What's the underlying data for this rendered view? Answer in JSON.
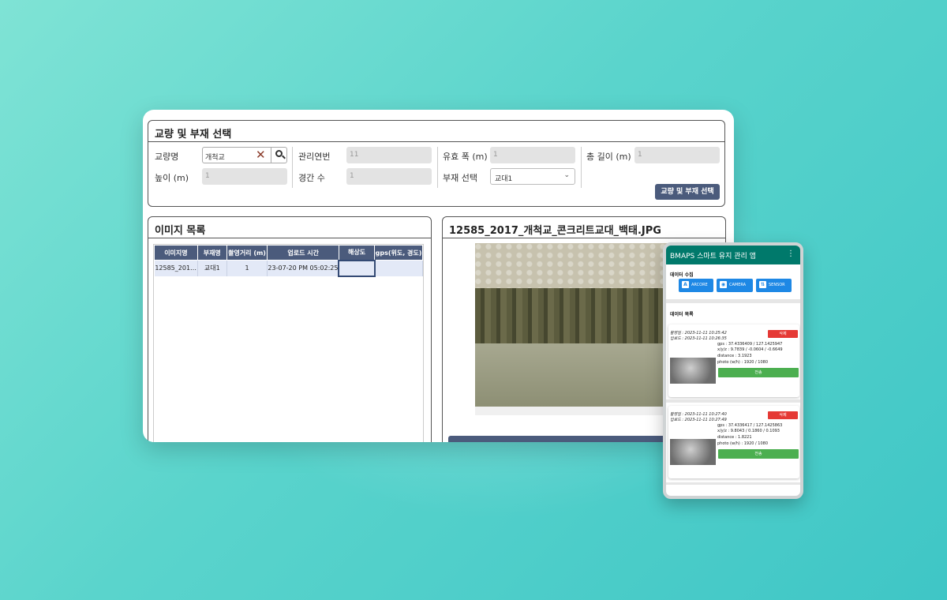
{
  "selection": {
    "title": "교량 및 부재 선택",
    "bridge_name_label": "교량명",
    "bridge_name_value": "개척교",
    "height_label": "높이 (m)",
    "height_value": "1",
    "mgmt_year_label": "관리연번",
    "mgmt_year_value": "11",
    "span_count_label": "경간 수",
    "span_count_value": "1",
    "width_label": "유효 폭 (m)",
    "width_value": "1",
    "member_label": "부재 선택",
    "member_value": "교대1",
    "total_length_label": "총 길이 (m)",
    "total_length_value": "1",
    "select_button": "교량 및 부재 선택"
  },
  "image_list": {
    "title": "이미지 목록",
    "columns": [
      "이미지명",
      "부재명",
      "촬영거리 (m)",
      "업로드 시간",
      "해상도",
      "gps(위도, 경도)"
    ],
    "rows": [
      [
        "12585_201…",
        "교대1",
        "1",
        "23-07-20 PM 05:02:25",
        "",
        ""
      ]
    ]
  },
  "image_view": {
    "title": "12585_2017_개척교_콘크리트교대_백태.JPG"
  },
  "phone": {
    "app_title": "BMAPS 스마트 유지 관리 앱",
    "collect_title": "데이터 수집",
    "buttons": [
      {
        "label": "ARCORE",
        "icon": "A"
      },
      {
        "label": "CAMERA",
        "icon": "camera-icon"
      },
      {
        "label": "SENSOR",
        "icon": "sensor-icon"
      }
    ],
    "list_title": "데이터 목록",
    "delete_label": "삭제",
    "send_label": "전송",
    "cards": [
      {
        "shot": "촬영일 : 2023-11-11 10:25:42",
        "upload": "업로드 : 2023-11-11 10:26:35",
        "gps": "gps : 37.4336409 / 127.1425947",
        "xyz": "x/y/z : 9.7839 / -0.0604 / -0.6649",
        "distance": "distance : 3.1923",
        "photo": "photo (w/h) : 1920 / 1080"
      },
      {
        "shot": "촬영일 : 2023-11-11 10:27:40",
        "upload": "업로드 : 2023-11-11 10:27:49",
        "gps": "gps : 37.4336417 / 127.1425863",
        "xyz": "x/y/z : 9.8043 / 0.1860 / 0.1093",
        "distance": "distance : 1.8221",
        "photo": "photo (w/h) : 1920 / 1080"
      }
    ]
  }
}
